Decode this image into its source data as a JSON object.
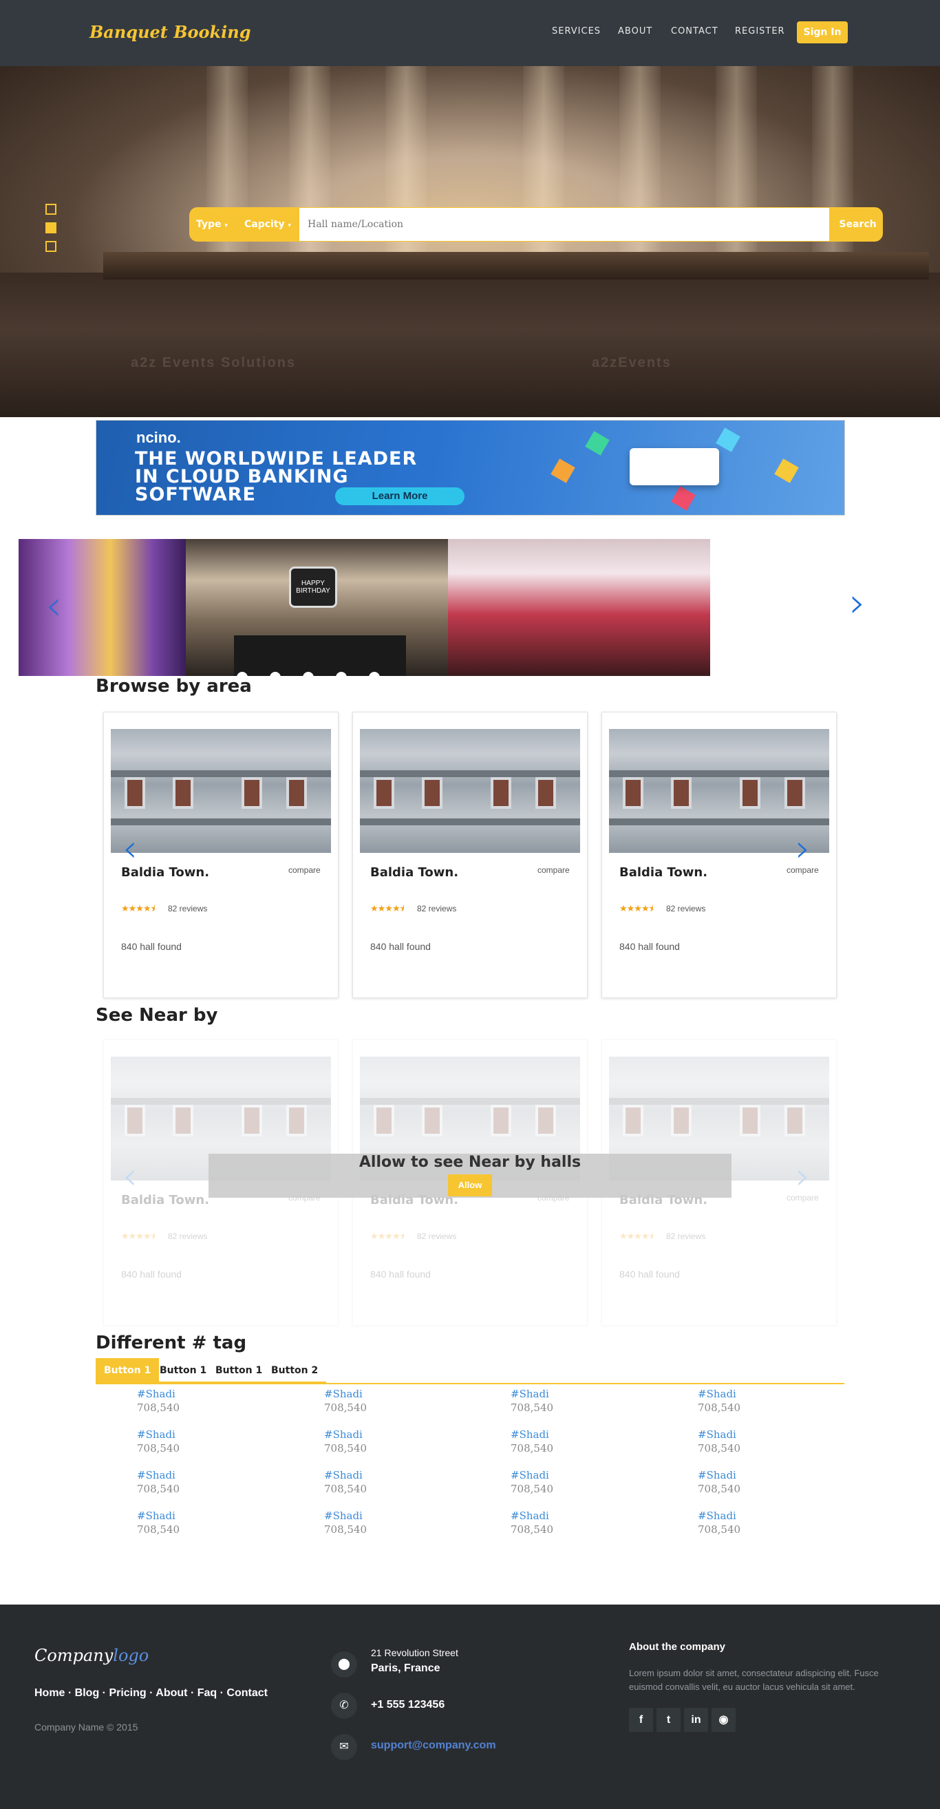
{
  "nav": {
    "brand": "Banquet Booking",
    "links": [
      "SERVICES",
      "ABOUT",
      "CONTACT",
      "REGISTER"
    ],
    "signin": "Sign In"
  },
  "hero": {
    "search": {
      "type_label": "Type",
      "capacity_label": "Capcity",
      "placeholder": "Hall name/Location",
      "button": "Search"
    },
    "watermark_left": "a2z Events Solutions",
    "watermark_right": "a2zEvents"
  },
  "ad": {
    "brand": "ncino.",
    "line1": "THE WORLDWIDE LEADER",
    "line2": "IN CLOUD BANKING",
    "line3": "SOFTWARE",
    "cta": "Learn More"
  },
  "gallery": {
    "birthday_sign": "HAPPY BIRTHDAY"
  },
  "browse": {
    "title": "Browse by area",
    "cards": [
      {
        "name": "Baldia Town.",
        "compare": "compare",
        "reviews": "82 reviews",
        "found": "840 hall found",
        "rating": 4.5
      },
      {
        "name": "Baldia Town.",
        "compare": "compare",
        "reviews": "82 reviews",
        "found": "840 hall found",
        "rating": 4.5
      },
      {
        "name": "Baldia Town.",
        "compare": "compare",
        "reviews": "82 reviews",
        "found": "840 hall found",
        "rating": 4.5
      }
    ]
  },
  "nearby": {
    "title": "See Near by",
    "overlay_text": "Allow to see Near by halls",
    "allow_button": "Allow",
    "cards": [
      {
        "name": "Baldia Town.",
        "compare": "compare",
        "reviews": "82 reviews",
        "found": "840 hall found"
      },
      {
        "name": "Baldia Town.",
        "compare": "compare",
        "reviews": "82 reviews",
        "found": "840 hall found"
      },
      {
        "name": "Baldia Town.",
        "compare": "compare",
        "reviews": "82 reviews",
        "found": "840 hall found"
      }
    ]
  },
  "tags": {
    "title": "Different # tag",
    "tabs": [
      "Button 1",
      "Button 1",
      "Button 1",
      "Button 2"
    ],
    "tag_name": "#Shadi",
    "tag_count": "708,540"
  },
  "footer": {
    "logo_a": "Company",
    "logo_b": "logo",
    "links": "Home · Blog · Pricing · About · Faq · Contact",
    "copyright": "Company Name © 2015",
    "address_line1": "21 Revolution Street",
    "address_line2": "Paris, France",
    "phone": "+1 555 123456",
    "email": "support@company.com",
    "about_heading": "About the company",
    "about_text": "Lorem ipsum dolor sit amet, consectateur adispicing elit. Fusce euismod convallis velit, eu auctor lacus vehicula sit amet."
  },
  "colors": {
    "accent": "#f7c531",
    "nav_bg": "#343a40",
    "footer_bg": "#292c2f",
    "link_blue": "#3b8bd8"
  }
}
